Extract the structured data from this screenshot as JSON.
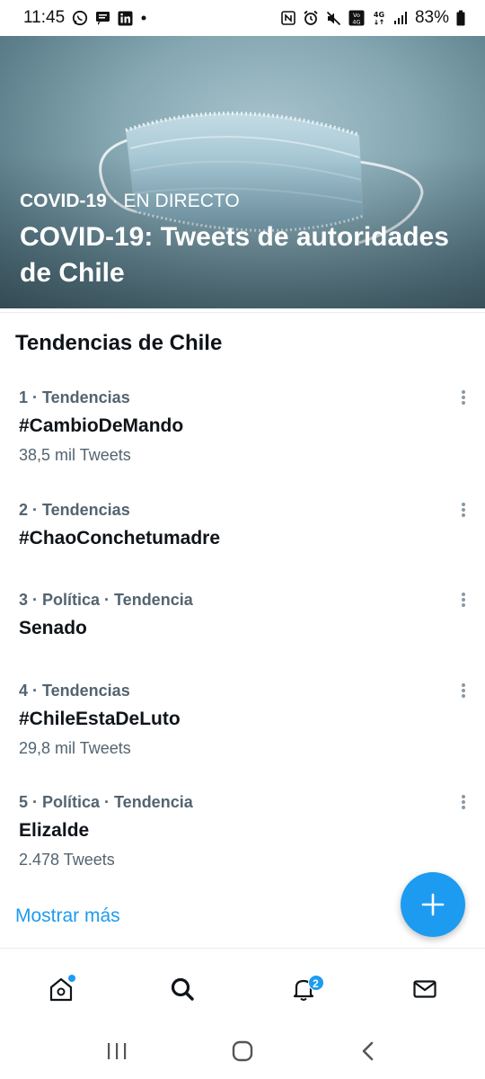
{
  "status_bar": {
    "time": "11:45",
    "battery": "83%",
    "left_icons": [
      "whatsapp-icon",
      "message-icon",
      "linkedin-icon",
      "dot-icon"
    ],
    "right_icons": [
      "nfc-icon",
      "alarm-icon",
      "mute-icon",
      "volte-icon",
      "4g-icon",
      "signal-icon",
      "battery-icon"
    ]
  },
  "hero": {
    "kicker_topic": "COVID-19",
    "kicker_sep": " · ",
    "kicker_live": "EN DIRECTO",
    "title": "COVID-19: Tweets de autoridades de Chile"
  },
  "section_title": "Tendencias de Chile",
  "trends": [
    {
      "meta": "1 · Tendencias",
      "name": "#CambioDeMando",
      "count": "38,5 mil Tweets"
    },
    {
      "meta": "2 · Tendencias",
      "name": "#ChaoConchetumadre",
      "count": ""
    },
    {
      "meta": "3 · Política · Tendencia",
      "name": "Senado",
      "count": ""
    },
    {
      "meta": "4 · Tendencias",
      "name": "#ChileEstaDeLuto",
      "count": "29,8 mil Tweets"
    },
    {
      "meta": "5 · Política · Tendencia",
      "name": "Elizalde",
      "count": "2.478 Tweets"
    }
  ],
  "show_more": "Mostrar más",
  "tabbar": {
    "notifications_badge": "2"
  },
  "colors": {
    "accent": "#1d9bf0",
    "text_primary": "#0f1419",
    "text_secondary": "#536471"
  }
}
